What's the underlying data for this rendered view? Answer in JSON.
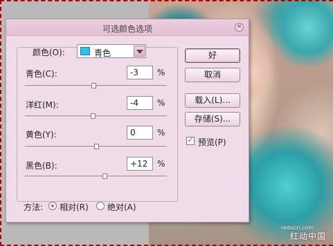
{
  "dialog": {
    "title": "可选颜色选项",
    "close_icon": "close-icon"
  },
  "colors": {
    "label": "颜色(O):",
    "selected": "青色",
    "swatch_color": "#2ec2ef"
  },
  "sliders": [
    {
      "label": "青色(C):",
      "value": "-3",
      "unit": "%",
      "position": 0.485
    },
    {
      "label": "洋红(M):",
      "value": "-4",
      "unit": "%",
      "position": 0.48
    },
    {
      "label": "黄色(Y):",
      "value": "0",
      "unit": "%",
      "position": 0.5
    },
    {
      "label": "黑色(B):",
      "value": "+12",
      "unit": "%",
      "position": 0.56
    }
  ],
  "buttons": {
    "ok": "好",
    "cancel": "取消",
    "load": "载入(L)...",
    "save": "存储(S)..."
  },
  "preview": {
    "label": "预览(P)",
    "checked": true
  },
  "method": {
    "label": "方法:",
    "relative": "相对(R)",
    "absolute": "绝对(A)",
    "selected": "relative"
  },
  "watermark": {
    "text": "红动中国",
    "small": "redocn.com"
  }
}
